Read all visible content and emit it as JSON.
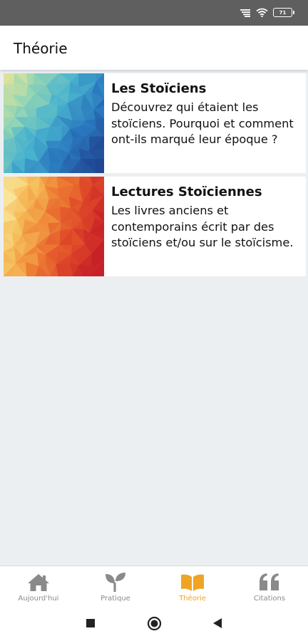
{
  "status_bar": {
    "battery": "71"
  },
  "header": {
    "title": "Théorie"
  },
  "cards": [
    {
      "title": "Les Stoïciens",
      "description": "Découvrez qui étaient les stoïciens. Pourquoi et comment ont-ils marqué leur époque ?"
    },
    {
      "title": "Lectures Stoïciennes",
      "description": "Les livres anciens et contemporains écrit par des stoïciens et/ou sur le stoïcisme."
    }
  ],
  "bottom_nav": {
    "items": [
      {
        "label": "Aujourd'hui",
        "icon": "home-icon"
      },
      {
        "label": "Pratique",
        "icon": "sprout-icon"
      },
      {
        "label": "Théorie",
        "icon": "book-icon",
        "active": true
      },
      {
        "label": "Citations",
        "icon": "quote-icon"
      }
    ]
  },
  "colors": {
    "accent": "#f0a425",
    "inactive": "#8a8a8a",
    "background": "#eceff2",
    "status_bar": "#5f5f5f"
  }
}
